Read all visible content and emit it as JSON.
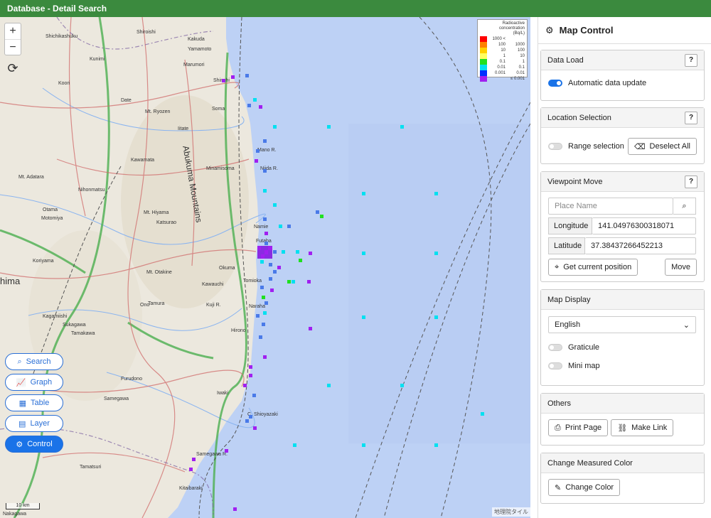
{
  "header": {
    "title": "Database - Detail Search"
  },
  "map": {
    "zoom_in": "+",
    "zoom_out": "−",
    "scale": "10 km",
    "attribution": "地理院タイル",
    "place_labels": [
      {
        "name": "Abukuma Mountains"
      },
      {
        "name": "Minamisoma"
      },
      {
        "name": "Namie"
      },
      {
        "name": "Futaba"
      },
      {
        "name": "Okuma"
      },
      {
        "name": "Tomioka"
      },
      {
        "name": "Naraha"
      },
      {
        "name": "Hirono"
      },
      {
        "name": "Iwaki"
      },
      {
        "name": "Kawauchi"
      },
      {
        "name": "Tamura"
      },
      {
        "name": "Ono"
      },
      {
        "name": "Sukagawa"
      },
      {
        "name": "Samegawa"
      },
      {
        "name": "Tamatsuri"
      },
      {
        "name": "Soma"
      },
      {
        "name": "Kawamata"
      },
      {
        "name": "Iitate"
      },
      {
        "name": "Katsurao"
      },
      {
        "name": "Motomiya"
      },
      {
        "name": "Koriyama"
      },
      {
        "name": "Tamakawa"
      },
      {
        "name": "Furudono"
      },
      {
        "name": "Kitaibaraki"
      },
      {
        "name": "Nakagawa"
      },
      {
        "name": "Date"
      },
      {
        "name": "Koori"
      },
      {
        "name": "Shichikashuku"
      },
      {
        "name": "Shiroishi"
      },
      {
        "name": "Kakuda"
      },
      {
        "name": "Yamamoto"
      },
      {
        "name": "Marumori"
      },
      {
        "name": "Kunimi"
      },
      {
        "name": "Shinchi"
      },
      {
        "name": "Otama"
      },
      {
        "name": "Nihonmatsu"
      },
      {
        "name": "Mt. Adatara"
      },
      {
        "name": "Mt. Ryozen"
      },
      {
        "name": "Mt. Otakine"
      },
      {
        "name": "Mt. Hiyama"
      },
      {
        "name": "Kagamiishi"
      },
      {
        "name": "hima"
      },
      {
        "name": "C. Shioyazaki"
      },
      {
        "name": "Samegawa R."
      },
      {
        "name": "Mano R."
      },
      {
        "name": "Niida R."
      },
      {
        "name": "Kuji R."
      }
    ]
  },
  "legend": {
    "title": "Radioactive concentration",
    "unit": "(Bq/L)",
    "rows": [
      {
        "color": "#ff0000",
        "lo": "1000 <",
        "hi": ""
      },
      {
        "color": "#ff8000",
        "lo": "100",
        "hi": "1000"
      },
      {
        "color": "#ffd000",
        "lo": "10",
        "hi": "100"
      },
      {
        "color": "#ffff60",
        "lo": "1",
        "hi": "10"
      },
      {
        "color": "#20e020",
        "lo": "0.1",
        "hi": "1"
      },
      {
        "color": "#00e0f0",
        "lo": "0.01",
        "hi": "0.1"
      },
      {
        "color": "#0030ff",
        "lo": "0.001",
        "hi": "0.01"
      },
      {
        "color": "#a020f0",
        "lo": "",
        "hi": "≤ 0.001"
      }
    ]
  },
  "left_buttons": [
    {
      "label": "Search",
      "icon": "search-icon",
      "active": false
    },
    {
      "label": "Graph",
      "icon": "graph-icon",
      "active": false
    },
    {
      "label": "Table",
      "icon": "table-icon",
      "active": false
    },
    {
      "label": "Layer",
      "icon": "layer-icon",
      "active": false
    },
    {
      "label": "Control",
      "icon": "gear-icon",
      "active": true
    }
  ],
  "panel": {
    "title": "Map Control",
    "data_load": {
      "title": "Data Load",
      "help": "?",
      "toggle_label": "Automatic data update",
      "toggle_on": true
    },
    "location": {
      "title": "Location Selection",
      "help": "?",
      "toggle_label": "Range selection",
      "toggle_on": false,
      "deselect": "Deselect All"
    },
    "viewpoint": {
      "title": "Viewpoint Move",
      "help": "?",
      "place_placeholder": "Place Name",
      "longitude_label": "Longitude",
      "longitude": "141.04976300318071",
      "latitude_label": "Latitude",
      "latitude": "37.38437266452213",
      "current_position": "Get current position",
      "move": "Move"
    },
    "display": {
      "title": "Map Display",
      "language": "English",
      "graticule": "Graticule",
      "minimap": "Mini map"
    },
    "others": {
      "title": "Others",
      "print": "Print Page",
      "link": "Make Link"
    },
    "color": {
      "title": "Change Measured Color",
      "button": "Change Color"
    }
  }
}
